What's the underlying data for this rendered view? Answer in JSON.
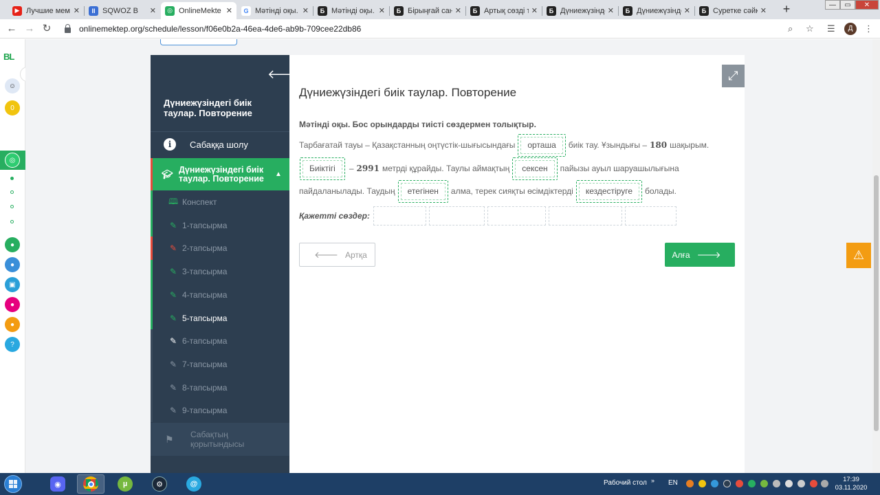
{
  "browser": {
    "tabs": [
      {
        "title": "Лучшие мем",
        "color": "#e62117",
        "glyph": "▶"
      },
      {
        "title": "SQWOZ B",
        "color": "#3b6fd4",
        "glyph": "II"
      },
      {
        "title": "OnlineMekte",
        "color": "#27ae60",
        "glyph": "◎"
      },
      {
        "title": "Мәтінді оқы.",
        "color": "#ffffff",
        "glyph": "G"
      },
      {
        "title": "Мәтінді оқы.",
        "color": "#222222",
        "glyph": "Б"
      },
      {
        "title": "Бірыңғай сан",
        "color": "#222222",
        "glyph": "Б"
      },
      {
        "title": "Артық сөзді т",
        "color": "#222222",
        "glyph": "Б"
      },
      {
        "title": "Дүниежүзінде",
        "color": "#222222",
        "glyph": "Б"
      },
      {
        "title": "Дүниежүзінде",
        "color": "#222222",
        "glyph": "Б"
      },
      {
        "title": "Суретке сәйк",
        "color": "#222222",
        "glyph": "Б"
      }
    ],
    "active_tab": 2,
    "url": "onlinemektep.org/schedule/lesson/f06e0b2a-46ea-4de6-ab9b-709cee22db86",
    "profile_initial": "Д"
  },
  "rail": {
    "logo": "BL",
    "badge": "0"
  },
  "sidebar": {
    "title": "Дүниежүзіндегі биік таулар. Повторение",
    "overview": "Сабаққа шолу",
    "lesson": "Дүниежүзіндегі биік таулар. Повторение",
    "items": [
      {
        "label": "Конспект",
        "icon": "book-icon"
      },
      {
        "label": "1-тапсырма",
        "icon": "edit-icon"
      },
      {
        "label": "2-тапсырма",
        "icon": "edit-icon"
      },
      {
        "label": "3-тапсырма",
        "icon": "edit-icon"
      },
      {
        "label": "4-тапсырма",
        "icon": "edit-icon"
      },
      {
        "label": "5-тапсырма",
        "icon": "edit-icon"
      },
      {
        "label": "6-тапсырма",
        "icon": "edit-icon"
      },
      {
        "label": "7-тапсырма",
        "icon": "edit-icon"
      },
      {
        "label": "8-тапсырма",
        "icon": "edit-icon"
      },
      {
        "label": "9-тапсырма",
        "icon": "edit-icon"
      }
    ],
    "summary": "Сабақтың қорытындысы"
  },
  "content": {
    "title": "Дүниежүзіндегі биік таулар. Повторение",
    "instruction": "Мәтінді оқы. Бос орындарды тиісті сөздермен толықтыр.",
    "line1": {
      "t1": "Тарбағатай тауы – Қазақстанның оңтүстік-шығысындағы",
      "w1": "орташа",
      "t2": "биік тау. Ұзындығы –",
      "n1": "180",
      "t3": "шақырым."
    },
    "line2": {
      "w1": "Биіктігі",
      "t1": "–",
      "n1": "2991",
      "t2": "метрді құрайды. Таулы аймақтың",
      "w2": "сексен",
      "t3": "пайызы ауыл шаруашылығына"
    },
    "line3": {
      "t1": "пайдаланылады. Таудың",
      "w1": "етегінен",
      "t2": "алма, терек сияқты өсімдіктерді",
      "w2": "кездестіруге",
      "t3": "болады."
    },
    "needed_label": "Қажетті сөздер:",
    "back_label": "Артқа",
    "next_label": "Алға"
  },
  "taskbar": {
    "desktop_label": "Рабочий стол",
    "lang": "EN",
    "time": "17:39",
    "date": "03.11.2020"
  },
  "colors": {
    "accent": "#27ae60",
    "sidebar": "#2d3e50",
    "warning": "#f39c12"
  }
}
